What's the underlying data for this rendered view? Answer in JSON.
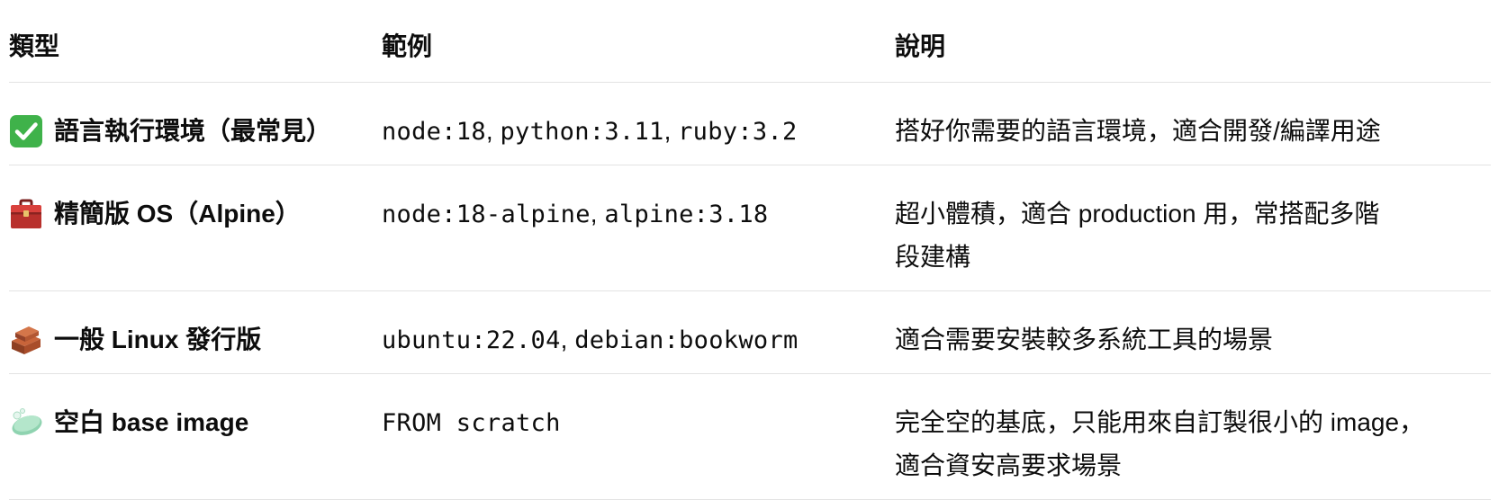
{
  "header": {
    "type": "類型",
    "example": "範例",
    "description": "說明"
  },
  "rows": [
    {
      "icon": "check-mark-button-icon",
      "type": "語言執行環境（最常見）",
      "examples": [
        "node:18",
        "python:3.11",
        "ruby:3.2"
      ],
      "description": "搭好你需要的語言環境，適合開發/編譯用途"
    },
    {
      "icon": "toolbox-icon",
      "type": "精簡版 OS（Alpine）",
      "examples": [
        "node:18-alpine",
        "alpine:3.18"
      ],
      "description": "超小體積，適合 production 用，常搭配多階段建構"
    },
    {
      "icon": "bricks-icon",
      "type": "一般 Linux 發行版",
      "examples": [
        "ubuntu:22.04",
        "debian:bookworm"
      ],
      "description": "適合需要安裝較多系統工具的場景"
    },
    {
      "icon": "soap-icon",
      "type": "空白 base image",
      "examples": [
        "FROM scratch"
      ],
      "description": "完全空的基底，只能用來自訂製很小的 image，適合資安高要求場景"
    }
  ],
  "separator": ", ",
  "colors": {
    "text": "#0d0d0d",
    "border": "#e3e3e3",
    "check_green": "#3fb24a",
    "toolbox_red": "#c8322f",
    "brick": "#a0522d",
    "soap": "#8fd3b0"
  }
}
